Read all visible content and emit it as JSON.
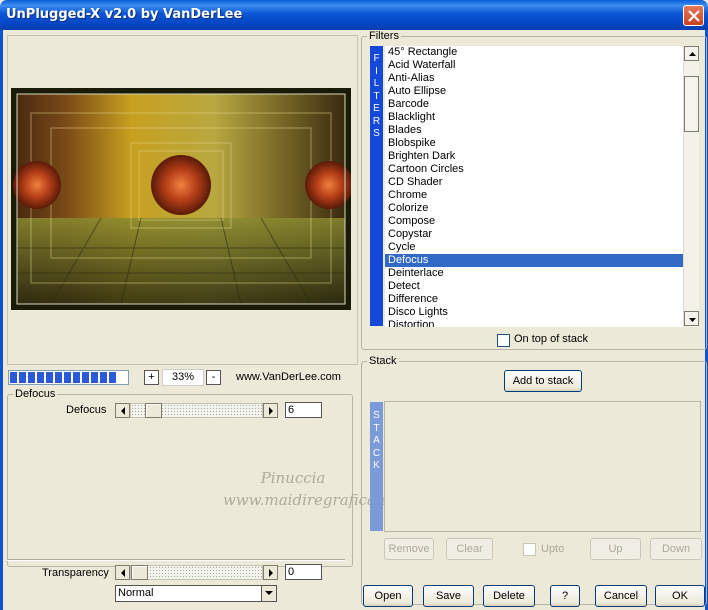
{
  "window": {
    "title": "UnPlugged-X v2.0 by VanDerLee"
  },
  "preview": {
    "progress_segments": 12,
    "zoom_value": "33%",
    "zoom_in_label": "+",
    "zoom_out_label": "-",
    "website": "www.VanDerLee.com"
  },
  "effect_group": {
    "title": "Defocus",
    "slider_label": "Defocus",
    "slider_value": "6",
    "transparency_label": "Transparency",
    "transparency_value": "0",
    "blend_mode": "Normal"
  },
  "filters": {
    "title": "Filters",
    "band_text": [
      "F",
      "I",
      "L",
      "T",
      "E",
      "R",
      "S"
    ],
    "items": [
      "45° Rectangle",
      "Acid Waterfall",
      "Anti-Alias",
      "Auto Ellipse",
      "Barcode",
      "Blacklight",
      "Blades",
      "Blobspike",
      "Brighten Dark",
      "Cartoon Circles",
      "CD Shader",
      "Chrome",
      "Colorize",
      "Compose",
      "Copystar",
      "Cycle",
      "Defocus",
      "Deinterlace",
      "Detect",
      "Difference",
      "Disco Lights",
      "Distortion"
    ],
    "selected": "Defocus",
    "on_top_label": "On top of stack"
  },
  "stack": {
    "title": "Stack",
    "add_button": "Add to stack",
    "band_text": [
      "S",
      "T",
      "A",
      "C",
      "K"
    ],
    "remove": "Remove",
    "clear": "Clear",
    "upto": "Upto",
    "up": "Up",
    "down": "Down"
  },
  "footer": {
    "open": "Open",
    "save": "Save",
    "delete": "Delete",
    "help": "?",
    "cancel": "Cancel",
    "ok": "OK"
  },
  "watermark": {
    "line1": "Pinuccia",
    "line2": "www.maidiregrafica.eu"
  },
  "colors": {
    "titlebar": "#0b53d0",
    "selection": "#316ac5",
    "filters_band": "#1448d8",
    "stack_band": "#7b9ad8"
  }
}
